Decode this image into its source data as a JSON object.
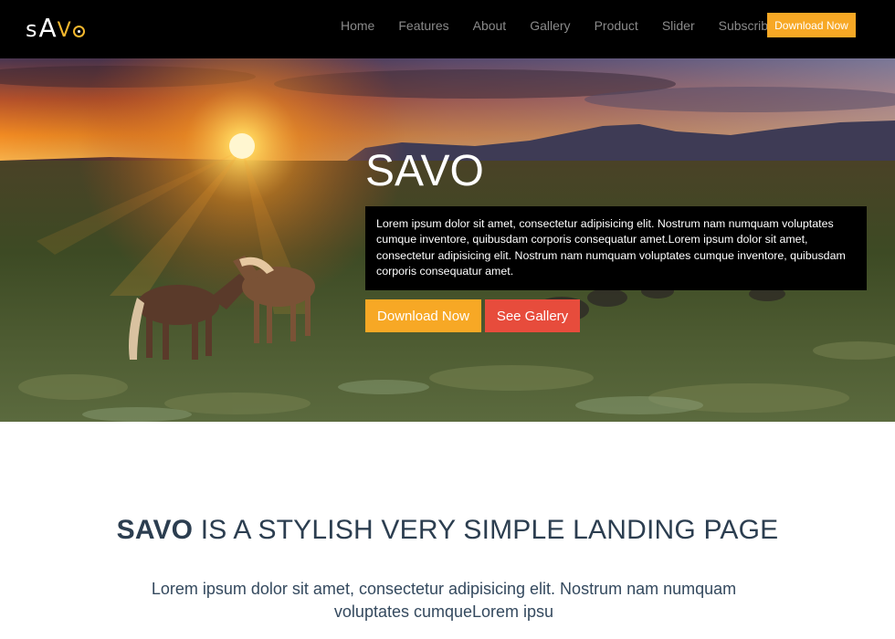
{
  "brand": {
    "logo_text": "sAVO",
    "accent_color": "#f7a825"
  },
  "nav": {
    "items": [
      "Home",
      "Features",
      "About",
      "Gallery",
      "Product",
      "Slider",
      "Subscribe"
    ],
    "cta_label": "Download Now"
  },
  "hero": {
    "title": "SAVO",
    "text": "Lorem ipsum dolor sit amet, consectetur adipisicing elit. Nostrum nam numquam voluptates cumque inventore, quibusdam corporis consequatur amet.Lorem ipsum dolor sit amet, consectetur adipisicing elit. Nostrum nam numquam voluptates cumque inventore, quibusdam corporis consequatur amet.",
    "primary_button": "Download Now",
    "secondary_button": "See Gallery",
    "primary_color": "#f7a825",
    "secondary_color": "#e74c3c"
  },
  "about": {
    "title_strong": "SAVO",
    "title_rest": " IS A STYLISH VERY SIMPLE LANDING PAGE",
    "text": "Lorem ipsum dolor sit amet, consectetur adipisicing elit. Nostrum nam numquam voluptates cumqueLorem ipsu"
  }
}
